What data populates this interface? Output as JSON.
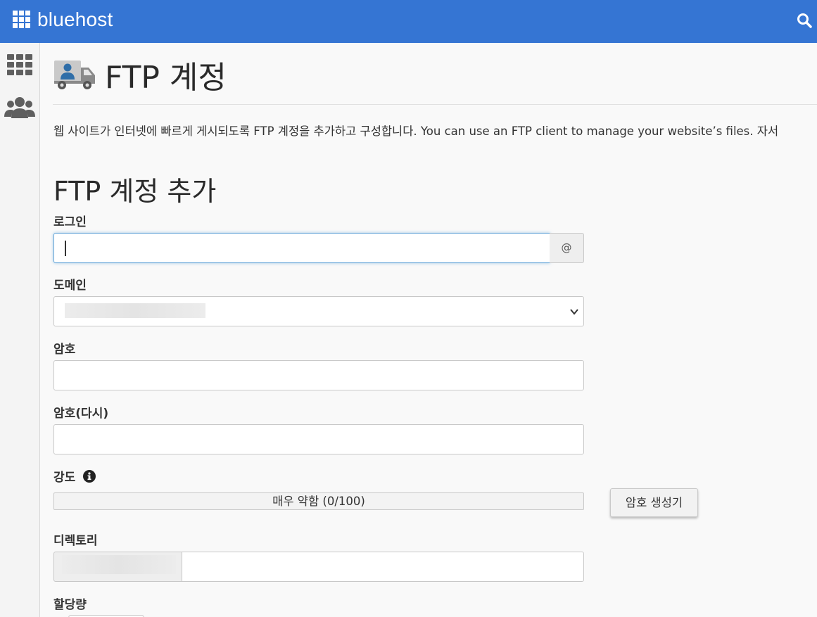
{
  "topbar": {
    "brand": "bluehost",
    "brand_icon": "apps-grid-icon",
    "search_icon": "search-icon",
    "color": "#3575d3"
  },
  "sidebar": {
    "items": [
      {
        "icon": "apps-grid-icon"
      },
      {
        "icon": "users-icon"
      }
    ]
  },
  "page": {
    "icon": "ftp-truck-icon",
    "title": "FTP 계정",
    "description": "웹 사이트가 인터넷에 빠르게 게시되도록 FTP 계정을 추가하고 구성합니다. You can use an FTP client to manage your website’s files. 자서"
  },
  "form": {
    "section_title": "FTP 계정 추가",
    "login_label": "로그인",
    "login_value": "",
    "at_addon": "@",
    "domain_label": "도메인",
    "domain_value": "",
    "password_label": "암호",
    "password_again_label": "암호(다시)",
    "strength_label": "강도",
    "strength_text": "매우 약함 (0/100)",
    "strength_value": 0,
    "generator_button": "암호 생성기",
    "directory_label": "디렉토리",
    "directory_value": "",
    "quota_label": "할당량"
  }
}
